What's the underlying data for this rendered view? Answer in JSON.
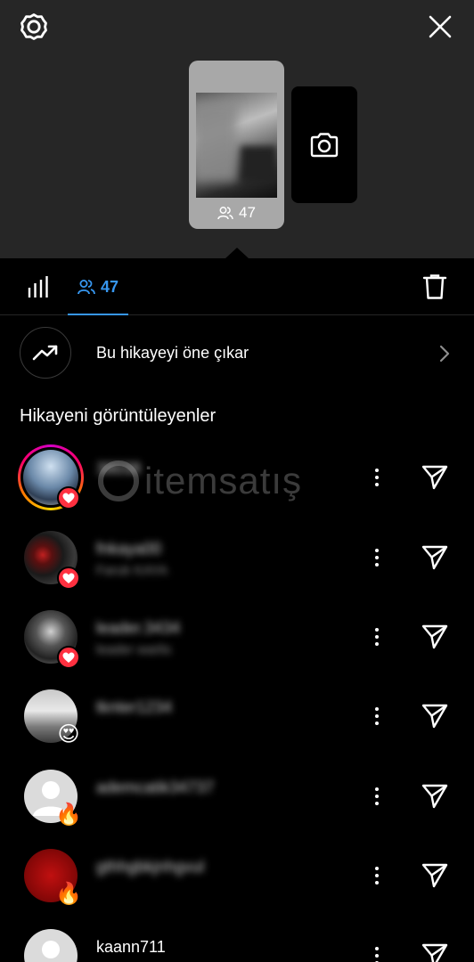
{
  "header": {
    "settings_icon": "gear-icon",
    "close_icon": "close-icon"
  },
  "story": {
    "view_count": "47"
  },
  "camera": {
    "icon": "camera-icon"
  },
  "tabs": {
    "stats_icon": "bar-chart-icon",
    "viewers_count": "47",
    "trash_icon": "trash-icon",
    "active_color": "#3797f0"
  },
  "promote": {
    "label": "Bu hikayeyi öne çıkar"
  },
  "viewers_section": {
    "title": "Hikayeni görüntüleyenler"
  },
  "watermark": {
    "text": "itemsatış"
  },
  "viewers": [
    {
      "username": "38038",
      "subname": "",
      "reaction": "heart",
      "avatar": "mountain-photo",
      "has_story_ring": true
    },
    {
      "username": "fnkaya00",
      "subname": "Faruk KAYA",
      "reaction": "heart",
      "avatar": "dark-photo",
      "has_story_ring": false
    },
    {
      "username": "leader.3434",
      "subname": "leader warlis",
      "reaction": "heart",
      "avatar": "bw-photo",
      "has_story_ring": false
    },
    {
      "username": "tknter1234",
      "subname": "",
      "reaction": "😍",
      "avatar": "castle-photo",
      "has_story_ring": false
    },
    {
      "username": "ademcatik34737",
      "subname": "",
      "reaction": "🔥",
      "avatar": "default-avatar",
      "has_story_ring": false
    },
    {
      "username": "gthhgbkjnhgvul",
      "subname": "",
      "reaction": "🔥",
      "avatar": "red-badge",
      "has_story_ring": false
    },
    {
      "username": "kaann711",
      "subname": "",
      "reaction": "",
      "avatar": "default-avatar",
      "has_story_ring": false
    }
  ]
}
